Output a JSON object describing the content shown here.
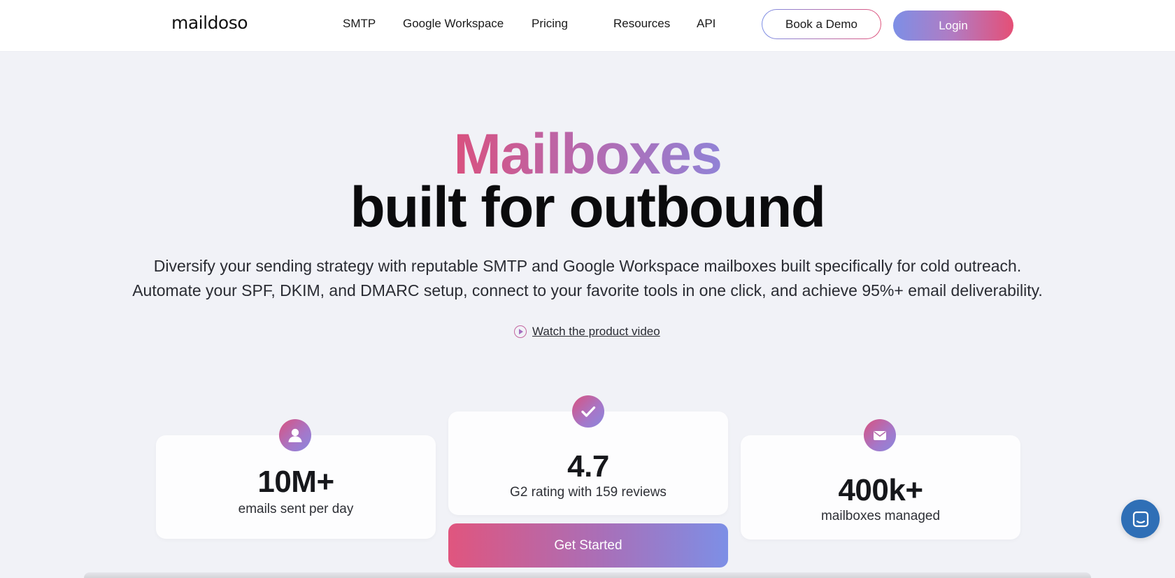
{
  "brand": {
    "logo_text": "maildoso"
  },
  "nav": {
    "items": [
      {
        "label": "SMTP"
      },
      {
        "label": "Google Workspace"
      },
      {
        "label": "Pricing"
      },
      {
        "label": "Resources"
      },
      {
        "label": "API"
      }
    ],
    "book_demo_label": "Book a Demo",
    "login_label": "Login"
  },
  "hero": {
    "title_highlight": "Mailboxes",
    "title_rest": "built for outbound",
    "description_line_1": "Diversify your sending strategy with reputable SMTP and Google Workspace mailboxes built specifically for cold outreach.",
    "description_line_2": "Automate your SPF, DKIM, and DMARC setup, connect to your favorite tools in one click, and achieve 95%+ email deliverability.",
    "video_link_label": "Watch the product video"
  },
  "stats": [
    {
      "icon": "user-icon",
      "value": "10M+",
      "label": "emails sent per day"
    },
    {
      "icon": "check-icon",
      "value": "4.7",
      "label": "G2 rating with 159 reviews"
    },
    {
      "icon": "envelope-icon",
      "value": "400k+",
      "label": "mailboxes managed"
    }
  ],
  "cta": {
    "get_started_label": "Get Started"
  },
  "colors": {
    "gradient_pink": "#e0557e",
    "gradient_purple": "#a96fb8",
    "gradient_blue": "#7d8fe6",
    "chat_blue": "#2f6fb6",
    "page_bg": "#f1f2f7"
  }
}
